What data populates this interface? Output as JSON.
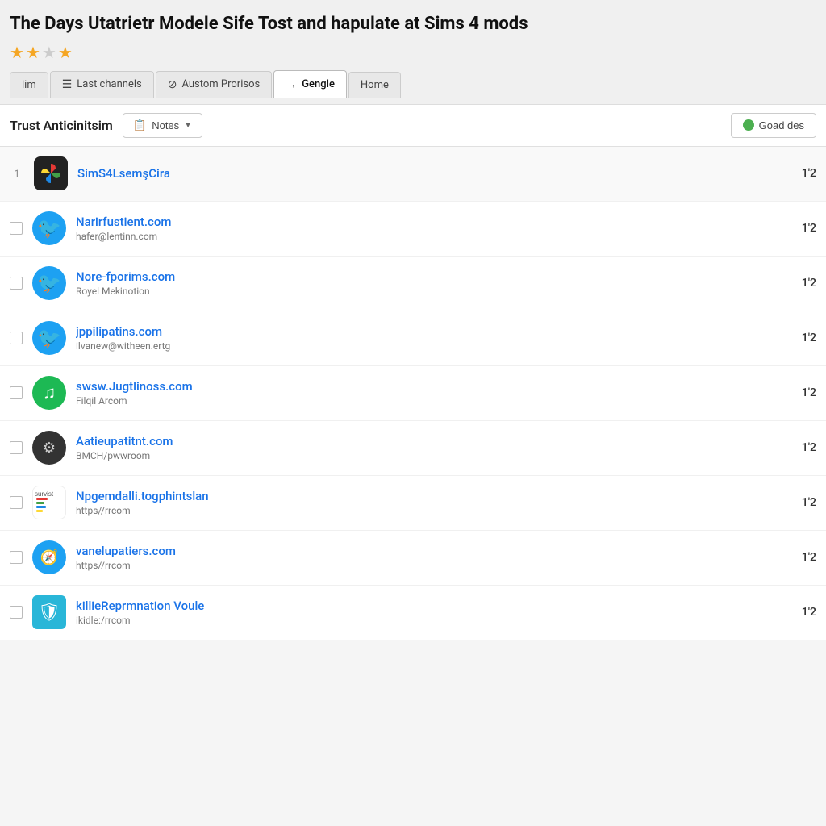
{
  "header": {
    "title": "The Days Utatrietr Modele Sife Tost and hapulate at Sims 4 mods",
    "stars": [
      true,
      true,
      false,
      true
    ],
    "tabs": [
      {
        "id": "slim",
        "label": "lim",
        "icon": "",
        "active": false
      },
      {
        "id": "last-channels",
        "label": "Last channels",
        "icon": "☰",
        "active": false
      },
      {
        "id": "custom-prorises",
        "label": "Austom Prorisos",
        "icon": "⊘",
        "active": false
      },
      {
        "id": "gengle",
        "label": "Gengle",
        "icon": "→",
        "active": true
      },
      {
        "id": "home",
        "label": "Home",
        "icon": "",
        "active": false
      }
    ]
  },
  "toolbar": {
    "title": "Trust Anticinitsim",
    "notes_label": "Notes",
    "notes_icon": "📋",
    "goad_label": "Goad des"
  },
  "list": {
    "items": [
      {
        "id": 1,
        "numbered": true,
        "number": "1",
        "logo_type": "pinwheel",
        "name": "SimS4LsemşCira",
        "sub": "",
        "value": "1'2"
      },
      {
        "id": 2,
        "numbered": false,
        "logo_type": "twitter-blue",
        "name": "Narirfustient.com",
        "sub": "hafer@lentinn.com",
        "value": "1'2"
      },
      {
        "id": 3,
        "numbered": false,
        "logo_type": "twitter-blue",
        "name": "Nore-fporims.com",
        "sub": "Royel Mekinotion",
        "value": "1'2"
      },
      {
        "id": 4,
        "numbered": false,
        "logo_type": "twitter-blue",
        "name": "jppilipatins.com",
        "sub": "ilvanew@witheen.ertg",
        "value": "1'2"
      },
      {
        "id": 5,
        "numbered": false,
        "logo_type": "spotify-green",
        "name": "swsw.Jugtlinoss.com",
        "sub": "Filqil Arcom",
        "value": "1'2"
      },
      {
        "id": 6,
        "numbered": false,
        "logo_type": "dark-circle",
        "name": "Aatieupatitnt.com",
        "sub": "BMCH/pwwroom",
        "value": "1'2"
      },
      {
        "id": 7,
        "numbered": false,
        "logo_type": "survlist",
        "name": "Npgemdalli.togphintslan",
        "sub": "https//rrcom",
        "value": "1'2"
      },
      {
        "id": 8,
        "numbered": false,
        "logo_type": "compass-blue",
        "name": "vanelupatiers.com",
        "sub": "https//rrcom",
        "value": "1'2"
      },
      {
        "id": 9,
        "numbered": false,
        "logo_type": "shield-blue",
        "name": "killieReprmnation Voule",
        "sub": "ikidle:/rrcom",
        "value": "1'2"
      }
    ]
  }
}
